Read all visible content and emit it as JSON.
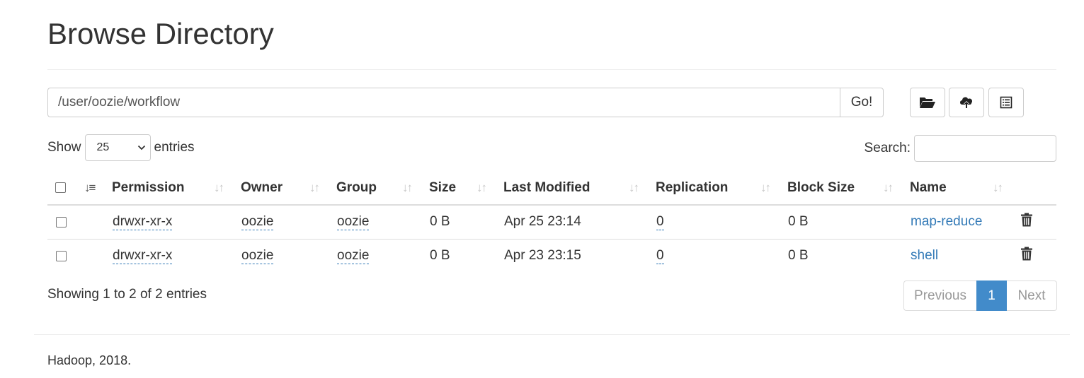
{
  "page_title": "Browse Directory",
  "path_bar": {
    "value": "/user/oozie/workflow",
    "go_label": "Go!"
  },
  "toolbar": {
    "icons": [
      "folder-open-icon",
      "cloud-upload-icon",
      "list-icon"
    ]
  },
  "length_control": {
    "show_label": "Show",
    "selected": "25",
    "entries_label": "entries"
  },
  "search": {
    "label": "Search:",
    "value": ""
  },
  "table": {
    "headers": {
      "permission": "Permission",
      "owner": "Owner",
      "group": "Group",
      "size": "Size",
      "last_modified": "Last Modified",
      "replication": "Replication",
      "block_size": "Block Size",
      "name": "Name"
    },
    "rows": [
      {
        "permission": "drwxr-xr-x",
        "owner": "oozie",
        "group": "oozie",
        "size": "0 B",
        "last_modified": "Apr 25 23:14",
        "replication": "0",
        "block_size": "0 B",
        "name": "map-reduce"
      },
      {
        "permission": "drwxr-xr-x",
        "owner": "oozie",
        "group": "oozie",
        "size": "0 B",
        "last_modified": "Apr 23 23:15",
        "replication": "0",
        "block_size": "0 B",
        "name": "shell"
      }
    ]
  },
  "info_text": "Showing 1 to 2 of 2 entries",
  "pagination": {
    "previous": "Previous",
    "current": "1",
    "next": "Next"
  },
  "footer": "Hadoop, 2018.",
  "colors": {
    "link": "#337ab7",
    "active_page": "#428bca",
    "border": "#dddddd"
  }
}
